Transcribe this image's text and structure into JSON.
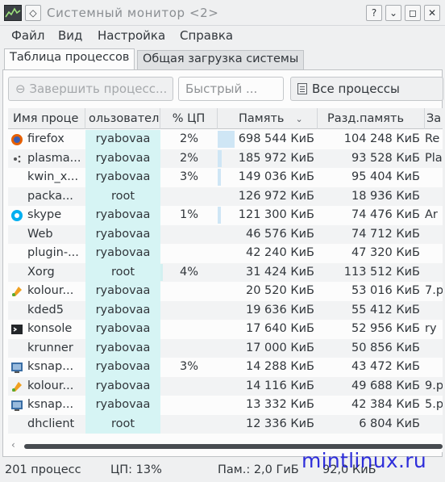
{
  "window": {
    "title": "Системный монитор <2>",
    "buttons": {
      "help": "?",
      "minimize": "⌄",
      "maximize": "◻",
      "close": "✕"
    }
  },
  "menu": [
    "Файл",
    "Вид",
    "Настройка",
    "Справка"
  ],
  "tabs": [
    "Таблица процессов",
    "Общая загрузка системы"
  ],
  "toolbar": {
    "kill_label": "Завершить процесс...",
    "search_placeholder": "Быстрый ...",
    "filter_value": "Все процессы"
  },
  "table": {
    "headers": [
      "Имя проце",
      "ользовател",
      "% ЦП",
      "Память",
      "Разд.память",
      "За"
    ],
    "rows": [
      {
        "name": "firefox",
        "user": "ryabovaa",
        "cpu": "2%",
        "mem": "698 544 КиБ",
        "shr": "104 248 КиБ",
        "extra": "Re",
        "icon": "firefox-icon",
        "mem_frac": 0.17,
        "cpu_frac": 0
      },
      {
        "name": "plasma...",
        "user": "ryabovaa",
        "cpu": "2%",
        "mem": "185 972 КиБ",
        "shr": "93 528 КиБ",
        "extra": "Pla",
        "icon": "plasma-icon",
        "mem_frac": 0.04,
        "cpu_frac": 0
      },
      {
        "name": "kwin_x...",
        "user": "ryabovaa",
        "cpu": "3%",
        "mem": "149 036 КиБ",
        "shr": "95 404 КиБ",
        "extra": "",
        "icon": "",
        "mem_frac": 0.035,
        "cpu_frac": 0
      },
      {
        "name": "packa...",
        "user": "root",
        "cpu": "",
        "mem": "126 972 КиБ",
        "shr": "18 936 КиБ",
        "extra": "",
        "icon": "",
        "mem_frac": 0,
        "cpu_frac": 0
      },
      {
        "name": "skype",
        "user": "ryabovaa",
        "cpu": "1%",
        "mem": "121 300 КиБ",
        "shr": "74 476 КиБ",
        "extra": "Ar",
        "icon": "skype-icon",
        "mem_frac": 0.03,
        "cpu_frac": 0
      },
      {
        "name": "Web",
        "user": "ryabovaa",
        "cpu": "",
        "mem": "46 576 КиБ",
        "shr": "74 712 КиБ",
        "extra": "",
        "icon": "",
        "mem_frac": 0,
        "cpu_frac": 0
      },
      {
        "name": "plugin-...",
        "user": "ryabovaa",
        "cpu": "",
        "mem": "42 240 КиБ",
        "shr": "47 320 КиБ",
        "extra": "",
        "icon": "",
        "mem_frac": 0,
        "cpu_frac": 0
      },
      {
        "name": "Xorg",
        "user": "root",
        "cpu": "4%",
        "mem": "31 424 КиБ",
        "shr": "113 512 КиБ",
        "extra": "",
        "icon": "",
        "mem_frac": 0,
        "cpu_frac": 0.04
      },
      {
        "name": "kolour...",
        "user": "ryabovaa",
        "cpu": "",
        "mem": "20 520 КиБ",
        "shr": "53 016 КиБ",
        "extra": "7.p",
        "icon": "kolourpaint-icon",
        "mem_frac": 0,
        "cpu_frac": 0
      },
      {
        "name": "kded5",
        "user": "ryabovaa",
        "cpu": "",
        "mem": "19 636 КиБ",
        "shr": "55 412 КиБ",
        "extra": "",
        "icon": "",
        "mem_frac": 0,
        "cpu_frac": 0
      },
      {
        "name": "konsole",
        "user": "ryabovaa",
        "cpu": "",
        "mem": "17 640 КиБ",
        "shr": "52 956 КиБ",
        "extra": "ry",
        "icon": "konsole-icon",
        "mem_frac": 0,
        "cpu_frac": 0
      },
      {
        "name": "krunner",
        "user": "ryabovaa",
        "cpu": "",
        "mem": "17 000 КиБ",
        "shr": "50 856 КиБ",
        "extra": "",
        "icon": "",
        "mem_frac": 0,
        "cpu_frac": 0
      },
      {
        "name": "ksnap...",
        "user": "ryabovaa",
        "cpu": "3%",
        "mem": "14 288 КиБ",
        "shr": "43 472 КиБ",
        "extra": "",
        "icon": "ksnapshot-icon",
        "mem_frac": 0,
        "cpu_frac": 0
      },
      {
        "name": "kolour...",
        "user": "ryabovaa",
        "cpu": "",
        "mem": "14 116 КиБ",
        "shr": "49 688 КиБ",
        "extra": "9.p",
        "icon": "kolourpaint-icon",
        "mem_frac": 0,
        "cpu_frac": 0
      },
      {
        "name": "ksnap...",
        "user": "ryabovaa",
        "cpu": "",
        "mem": "13 332 КиБ",
        "shr": "42 384 КиБ",
        "extra": "5.p",
        "icon": "ksnapshot-icon",
        "mem_frac": 0,
        "cpu_frac": 0
      },
      {
        "name": "dhclient",
        "user": "root",
        "cpu": "",
        "mem": "12 336 КиБ",
        "shr": "6 804 КиБ",
        "extra": "",
        "icon": "",
        "mem_frac": 0,
        "cpu_frac": 0
      }
    ]
  },
  "status": {
    "processes": "201 процесс",
    "cpu": "ЦП: 13%",
    "mem": "Пам.: 2,0 ГиБ",
    "swap": "92,0 КиБ"
  },
  "watermark": "mintlinux.ru",
  "colors": {
    "user_column_bg": "#d6f4f4",
    "mem_bar": "#cfe6f5",
    "watermark": "#1d1dd9"
  }
}
